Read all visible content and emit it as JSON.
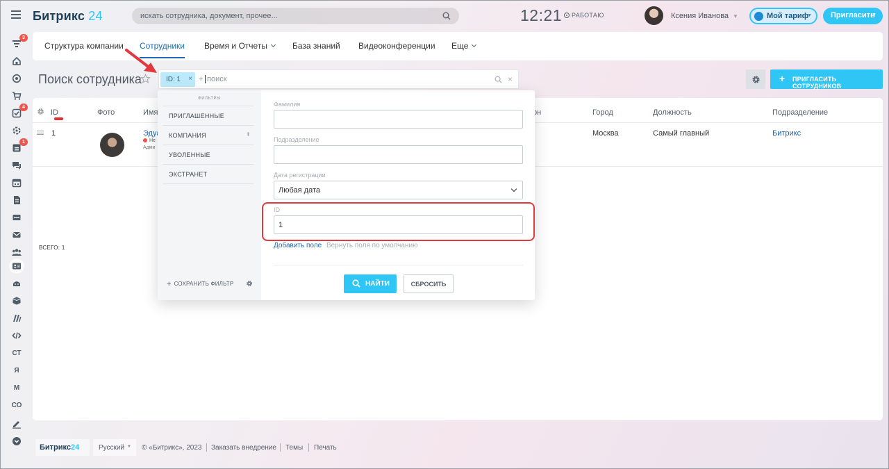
{
  "header": {
    "logo_text": "Битрикс",
    "logo_num": "24",
    "search_placeholder": "искать сотрудника, документ, прочее...",
    "time": "12:21",
    "work_status": "РАБОТАЮ",
    "user_name": "Ксения Иванова",
    "tariff_label": "Мой тариф",
    "invite_label": "Пригласить"
  },
  "sidebar": {
    "badges": {
      "filter": "3",
      "tasks": "4",
      "feed": "1"
    },
    "text_items": [
      "СТ",
      "Я",
      "М",
      "СО"
    ]
  },
  "tabs": [
    {
      "label": "Структура компании"
    },
    {
      "label": "Сотрудники"
    },
    {
      "label": "Время и Отчеты"
    },
    {
      "label": "База знаний"
    },
    {
      "label": "Видеоконференции"
    },
    {
      "label": "Еще"
    }
  ],
  "page": {
    "title": "Поиск сотрудника",
    "filter_chip": "ID: 1",
    "search_placeholder": "поиск",
    "invite_button": "ПРИГЛАСИТЬ СОТРУДНИКОВ"
  },
  "grid": {
    "columns": [
      "ID",
      "Фото",
      "Имя",
      "он",
      "Город",
      "Должность",
      "Подразделение"
    ],
    "row": {
      "id": "1",
      "name": "Эдуа",
      "status": "Не",
      "role": "Адми",
      "city": "Москва",
      "position": "Самый главный",
      "department": "Битрикс"
    },
    "total": "ВСЕГО: 1"
  },
  "filter_popup": {
    "presets_title": "ФИЛЬТРЫ",
    "presets": [
      "ПРИГЛАШЕННЫЕ",
      "КОМПАНИЯ",
      "УВОЛЕННЫЕ",
      "ЭКСТРАНЕТ"
    ],
    "save_filter": "СОХРАНИТЬ ФИЛЬТР",
    "fields": {
      "surname_label": "Фамилия",
      "surname_value": "",
      "department_label": "Подразделение",
      "department_value": "",
      "reg_date_label": "Дата регистрации",
      "reg_date_value": "Любая дата",
      "id_label": "ID",
      "id_value": "1"
    },
    "add_field": "Добавить поле",
    "restore_fields": "Вернуть поля по умолчанию",
    "find_button": "НАЙТИ",
    "reset_button": "СБРОСИТЬ"
  },
  "footer": {
    "logo_text": "Битрикс",
    "logo_num": "24",
    "language": "Русский",
    "copyright": "© «Битрикс», 2023",
    "order": "Заказать внедрение",
    "themes": "Темы",
    "print": "Печать"
  },
  "colors": {
    "accent": "#2fc6f6",
    "link": "#2067b0",
    "highlight": "#e0393e",
    "badge": "#f0554b"
  }
}
